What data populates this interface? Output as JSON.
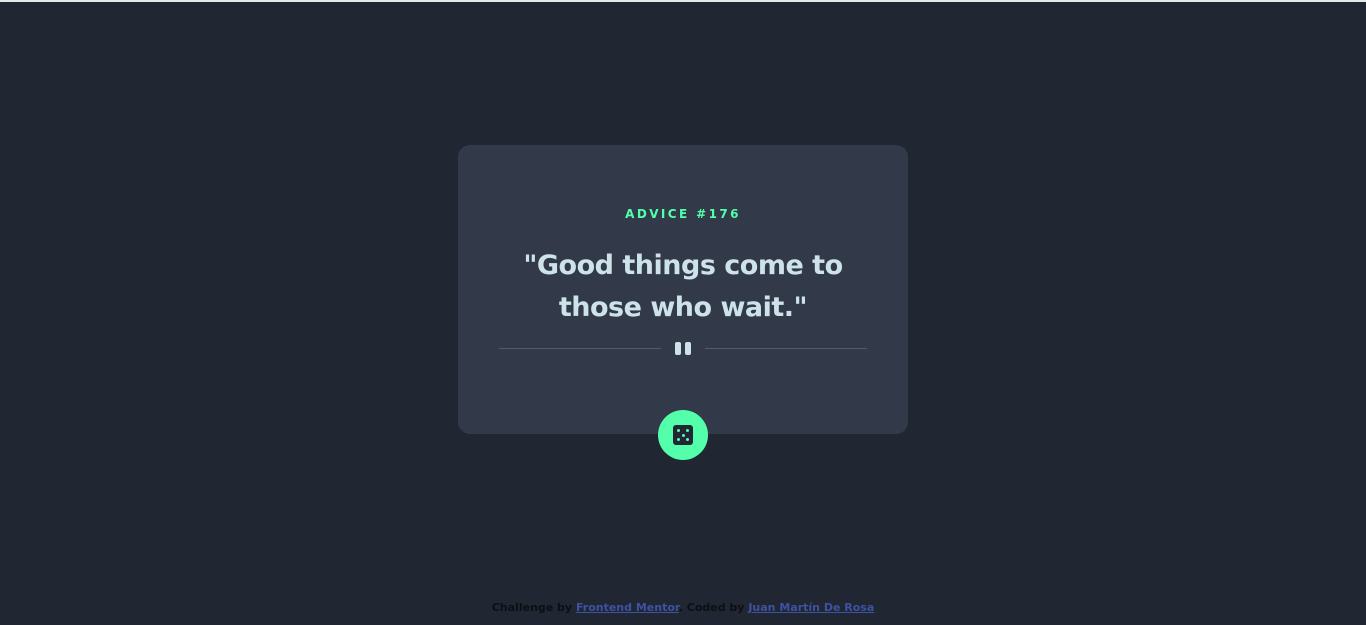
{
  "card": {
    "advice_label": "ADVICE #176",
    "quote": "\"Good things come to those who wait.\""
  },
  "dice_button": {
    "icon": "dice-icon"
  },
  "footer": {
    "challenge_prefix": "Challenge by",
    "frontend_mentor_link": "Frontend Mentor",
    "coded_prefix": ". Coded by",
    "author_link": "Juan Martín De Rosa"
  },
  "colors": {
    "background": "#202632",
    "card": "#323a49",
    "accent": "#53ffaa",
    "text": "#cee3e9",
    "divider": "#4f5d74",
    "link": "#3e52a3"
  }
}
